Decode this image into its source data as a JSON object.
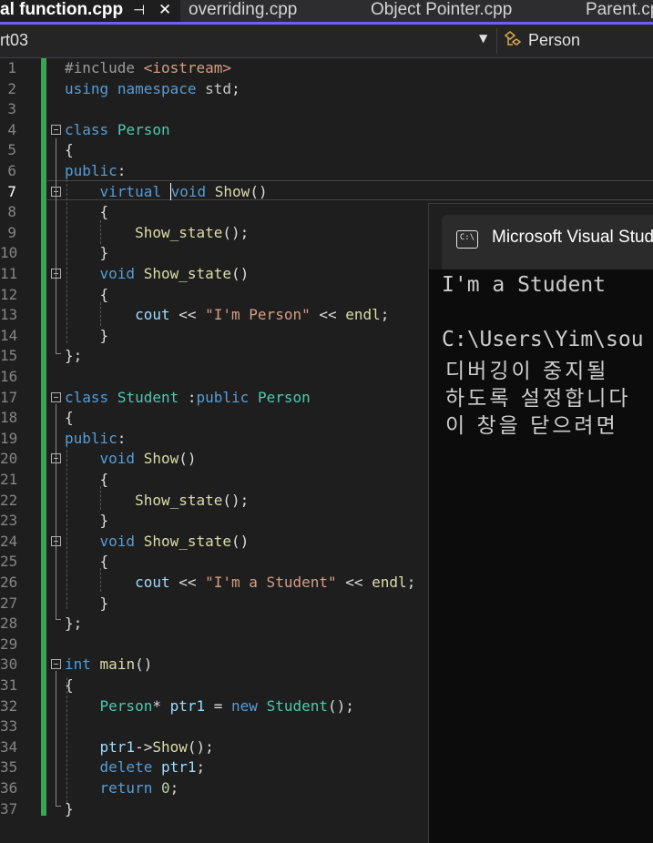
{
  "tabs": [
    {
      "label": "al function.cpp",
      "active": true
    },
    {
      "label": "overriding.cpp",
      "active": false
    },
    {
      "label": "Object Pointer.cpp",
      "active": false
    },
    {
      "label": "Parent.cp",
      "active": false
    }
  ],
  "tab_icons": {
    "pin": "⊣",
    "close": "✕"
  },
  "navbar": {
    "scope": "rt03",
    "member": "Person"
  },
  "editor": {
    "current_line": 7,
    "lines": [
      "1",
      "2",
      "3",
      "4",
      "5",
      "6",
      "7",
      "8",
      "9",
      "10",
      "11",
      "12",
      "13",
      "14",
      "15",
      "16",
      "17",
      "18",
      "19",
      "20",
      "21",
      "22",
      "23",
      "24",
      "25",
      "26",
      "27",
      "28",
      "29",
      "30",
      "31",
      "32",
      "33",
      "34",
      "35",
      "36",
      "37"
    ]
  },
  "console": {
    "title": "Microsoft Visual Stud",
    "icon_label": "C:\\",
    "output_line": "I'm a Student",
    "path_line": "C:\\Users\\Yim\\sou",
    "kr_line1": "디버깅이 중지될",
    "kr_line2": "하도록 설정합니다",
    "kr_line3": "이 창을 닫으려면"
  },
  "colors": {
    "accent": "#7160e8",
    "change_bar": "#3aa655",
    "keyword": "#569cd6",
    "type": "#4ec9b0",
    "function": "#dcdcaa",
    "string": "#d69d85"
  }
}
